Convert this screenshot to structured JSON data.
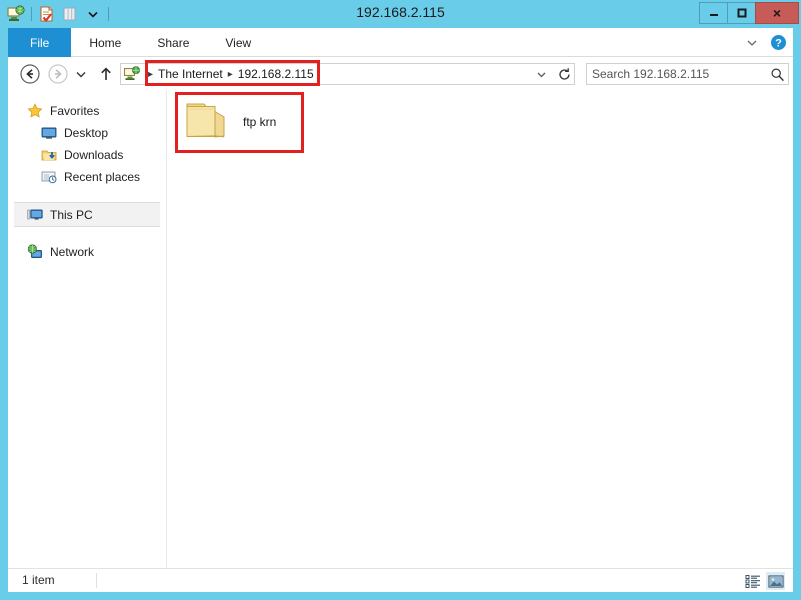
{
  "window": {
    "title": "192.168.2.115",
    "accent_color": "#69cdea",
    "close_color": "#c75b57",
    "highlight_color": "#e31f1f"
  },
  "quick_access": {
    "items": [
      {
        "name": "internet-location-icon",
        "tooltip": "The Internet"
      },
      {
        "name": "properties-icon",
        "tooltip": "Properties"
      },
      {
        "name": "new-folder-icon",
        "tooltip": "New folder"
      },
      {
        "name": "customize-dropdown-icon",
        "tooltip": "Customize Quick Access Toolbar"
      }
    ]
  },
  "window_controls": {
    "minimize": "—",
    "maximize": "❑",
    "close": "×"
  },
  "ribbon": {
    "tabs": [
      {
        "label": "File",
        "active": true
      },
      {
        "label": "Home",
        "active": false
      },
      {
        "label": "Share",
        "active": false
      },
      {
        "label": "View",
        "active": false
      }
    ],
    "expand_label": "∨",
    "help_label": "?"
  },
  "navigation": {
    "back_tooltip": "Back",
    "forward_tooltip": "Forward",
    "recent_tooltip": "Recent locations",
    "up_tooltip": "Up one level"
  },
  "address": {
    "crumbs": [
      {
        "label": "The Internet"
      },
      {
        "label": "192.168.2.115"
      }
    ],
    "separator": "▸",
    "dropdown_label": "∨",
    "refresh_label": "↻",
    "highlighted": true
  },
  "search": {
    "placeholder": "Search 192.168.2.115",
    "value": ""
  },
  "sidebar": {
    "items": [
      {
        "label": "Favorites",
        "icon": "star-icon",
        "level": 0,
        "selected": false
      },
      {
        "label": "Desktop",
        "icon": "desktop-icon",
        "level": 1,
        "selected": false
      },
      {
        "label": "Downloads",
        "icon": "downloads-icon",
        "level": 1,
        "selected": false
      },
      {
        "label": "Recent places",
        "icon": "recent-places-icon",
        "level": 1,
        "selected": false
      },
      {
        "label": "This PC",
        "icon": "this-pc-icon",
        "level": 0,
        "selected": true
      },
      {
        "label": "Network",
        "icon": "network-icon",
        "level": 0,
        "selected": false
      }
    ]
  },
  "content": {
    "items": [
      {
        "label": "ftp krn",
        "type": "folder",
        "highlighted": true
      }
    ]
  },
  "status": {
    "item_count_text": "1 item",
    "views": [
      {
        "name": "details-view-button",
        "active": false
      },
      {
        "name": "large-icons-view-button",
        "active": true
      }
    ]
  }
}
